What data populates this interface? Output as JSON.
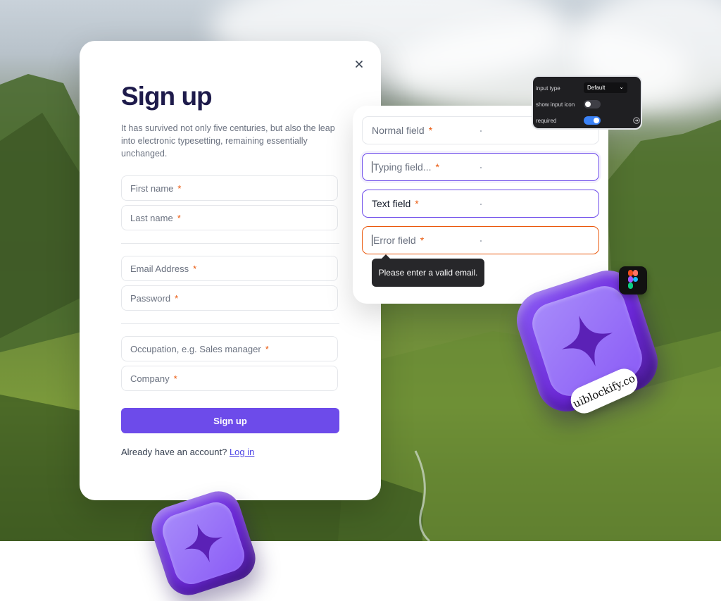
{
  "signup_card": {
    "title": "Sign up",
    "description": "It has survived not only five centuries, but also the leap into electronic typesetting, remaining essentially unchanged.",
    "fields": [
      {
        "placeholder": "First name",
        "required_mark": "*"
      },
      {
        "placeholder": "Last name",
        "required_mark": "*"
      },
      {
        "placeholder": "Email Address",
        "required_mark": "*"
      },
      {
        "placeholder": "Password",
        "required_mark": "*"
      },
      {
        "placeholder": "Occupation, e.g. Sales manager",
        "required_mark": "*"
      },
      {
        "placeholder": "Company",
        "required_mark": "*"
      }
    ],
    "submit_label": "Sign up",
    "footer_text": "Already have an account?",
    "login_link": "Log in"
  },
  "states_card": {
    "normal": {
      "label": "Normal field",
      "required_mark": "*"
    },
    "typing": {
      "label": "Typing field...",
      "required_mark": "*"
    },
    "text": {
      "label": "Text field",
      "required_mark": "*"
    },
    "error": {
      "label": "Error field",
      "required_mark": "*"
    },
    "tooltip": "Please enter a valid email."
  },
  "props_panel": {
    "input_type_label": "input type",
    "input_type_value": "Default",
    "show_icon_label": "show input icon",
    "show_icon_on": false,
    "required_label": "required",
    "required_on": true
  },
  "brand": {
    "sticker": "uiblockify.co"
  },
  "colors": {
    "accent": "#6d4bea",
    "error": "#ea580c",
    "title": "#1e1b4b"
  },
  "icons": [
    "close-icon",
    "chevron-down-icon",
    "sign-in-icon",
    "figma-icon",
    "sparkle-icon"
  ]
}
